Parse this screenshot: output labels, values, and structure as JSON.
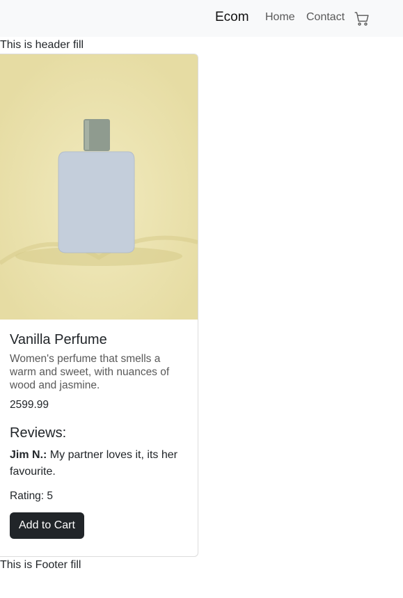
{
  "navbar": {
    "brand": "Ecom",
    "links": [
      "Home",
      "Contact"
    ],
    "cart_icon": "cart-icon"
  },
  "header_fill": "This is header fill",
  "product": {
    "image_icon": "perfume-bottle-image",
    "title": "Vanilla Perfume",
    "description": "Women's perfume that smells a warm and sweet, with nuances of wood and jasmine.",
    "price": "2599.99",
    "reviews_heading": "Reviews:",
    "review": {
      "author": "Jim N.:",
      "text": " My partner loves it, its her favourite."
    },
    "rating": "Rating: 5",
    "add_to_cart_label": "Add to Cart"
  },
  "footer_fill": "This is Footer fill"
}
